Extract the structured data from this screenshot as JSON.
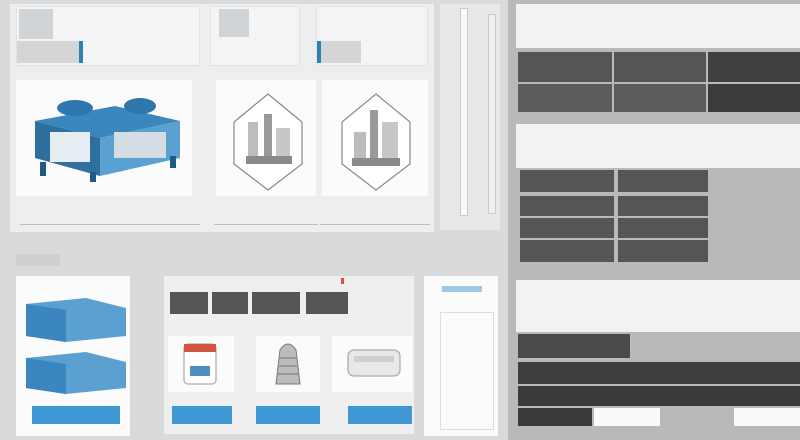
{
  "colors": {
    "accent": "#3f97d4",
    "alert_red": "#d2553f",
    "ok_green": "#4f9a52",
    "dark_cell": "#555555"
  },
  "top_cards": [
    {
      "title": "",
      "caption": ""
    },
    {
      "title": "",
      "caption": ""
    },
    {
      "title": "",
      "caption": ""
    }
  ],
  "products": [
    {
      "icon": "machine-icon",
      "caption": ""
    },
    {
      "icon": "equipment-icon",
      "caption": ""
    },
    {
      "icon": "equipment-icon",
      "caption": ""
    },
    {
      "icon": "equipment-icon",
      "caption": ""
    }
  ],
  "section_label": "",
  "left_chart_label": "",
  "mid_tabs": [
    "",
    "",
    "",
    ""
  ],
  "mid_items": [
    {
      "icon": "canister-icon",
      "button": ""
    },
    {
      "icon": "nozzle-icon",
      "button": ""
    },
    {
      "icon": "housing-icon",
      "button": ""
    }
  ],
  "list_panel": {
    "title": "",
    "items": [
      "",
      "",
      "",
      "",
      "",
      ""
    ]
  },
  "right_panels": [
    {
      "label": "",
      "value": "",
      "grid": [
        "",
        "",
        "",
        "",
        "",
        ""
      ]
    },
    {
      "label": "",
      "value": "",
      "grid": [
        "",
        "",
        "",
        "",
        "",
        ""
      ]
    },
    {
      "label": "",
      "value": "",
      "grid": [
        "",
        "",
        ""
      ]
    }
  ]
}
